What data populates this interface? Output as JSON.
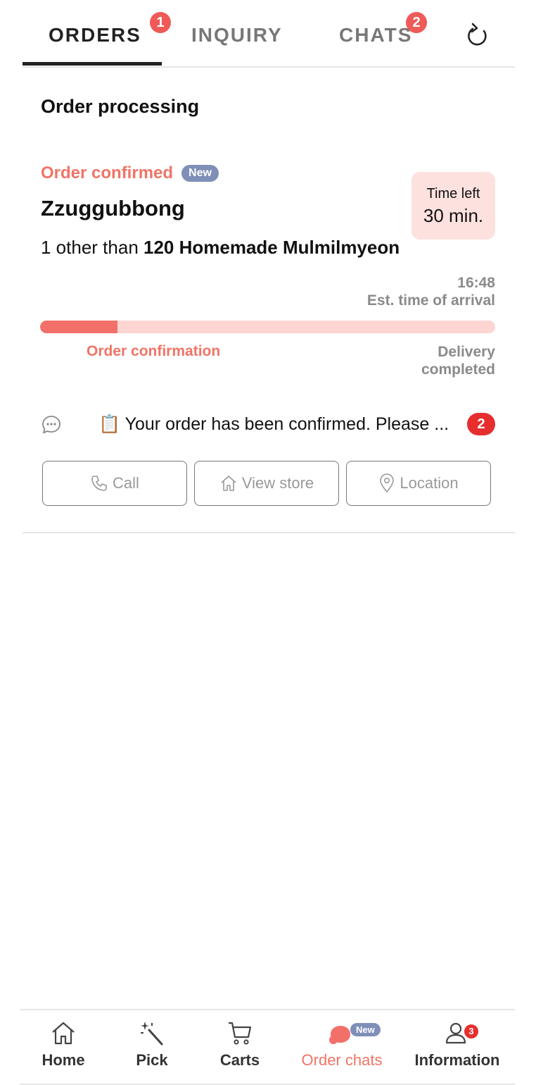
{
  "tabs": [
    {
      "label": "ORDERS",
      "badge": "1",
      "active": true
    },
    {
      "label": "INQUIRY",
      "badge": "",
      "active": false
    },
    {
      "label": "CHATS",
      "badge": "2",
      "active": false
    }
  ],
  "section_title": "Order processing",
  "order": {
    "status": "Order confirmed",
    "new_label": "New",
    "store_name": "Zzuggubbong",
    "description_prefix": "1 other than ",
    "description_item": "120 Homemade Mulmilmyeon",
    "time_left_label": "Time left",
    "time_left_value": "30 min.",
    "eta_time": "16:48",
    "eta_label": "Est. time of arrival",
    "progress_fraction": 0.17,
    "step_current": "Order confirmation",
    "step_end": "Delivery completed",
    "last_message": "📋 Your order has been confirmed. Please ...",
    "unread_count": "2"
  },
  "actions": {
    "call": "Call",
    "view_store": "View store",
    "location": "Location"
  },
  "bottom_nav": {
    "home": "Home",
    "pick": "Pick",
    "carts": "Carts",
    "order_chats": "Order chats",
    "order_chats_new": "New",
    "information": "Information",
    "information_count": "3"
  },
  "colors": {
    "accent": "#f07466",
    "badge_red": "#e62e2e",
    "new_pill": "#7f8fb8",
    "progress_track": "#fdd5d2",
    "time_box": "#fde1df"
  }
}
